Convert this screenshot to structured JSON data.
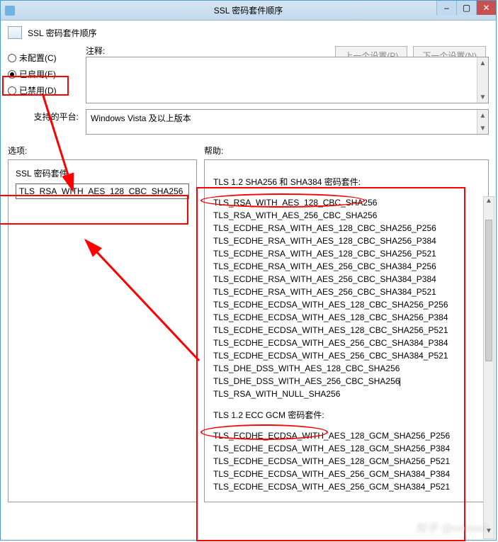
{
  "window": {
    "title": "SSL 密码套件顺序",
    "buttons": {
      "min": "–",
      "max": "▢",
      "close": "✕"
    }
  },
  "header": {
    "title": "SSL 密码套件顺序"
  },
  "nav": {
    "prev": "上一个设置(P)",
    "next": "下一个设置(N)"
  },
  "radios": {
    "not_configured": "未配置(C)",
    "enabled": "已启用(E)",
    "disabled": "已禁用(D)"
  },
  "labels": {
    "comment": "注释:",
    "platform": "支持的平台:",
    "options": "选项:",
    "help": "帮助:",
    "suite": "SSL 密码套件"
  },
  "platform_text": "Windows Vista 及以上版本",
  "suite_input": "TLS_RSA_WITH_AES_128_CBC_SHA256",
  "help": {
    "h1": "TLS 1.2 SHA256 和 SHA384 密码套件:",
    "list1": [
      "TLS_RSA_WITH_AES_128_CBC_SHA256",
      "TLS_RSA_WITH_AES_256_CBC_SHA256",
      "TLS_ECDHE_RSA_WITH_AES_128_CBC_SHA256_P256",
      "TLS_ECDHE_RSA_WITH_AES_128_CBC_SHA256_P384",
      "TLS_ECDHE_RSA_WITH_AES_128_CBC_SHA256_P521",
      "TLS_ECDHE_RSA_WITH_AES_256_CBC_SHA384_P256",
      "TLS_ECDHE_RSA_WITH_AES_256_CBC_SHA384_P384",
      "TLS_ECDHE_RSA_WITH_AES_256_CBC_SHA384_P521",
      "TLS_ECDHE_ECDSA_WITH_AES_128_CBC_SHA256_P256",
      "TLS_ECDHE_ECDSA_WITH_AES_128_CBC_SHA256_P384",
      "TLS_ECDHE_ECDSA_WITH_AES_128_CBC_SHA256_P521",
      "TLS_ECDHE_ECDSA_WITH_AES_256_CBC_SHA384_P384",
      "TLS_ECDHE_ECDSA_WITH_AES_256_CBC_SHA384_P521",
      "TLS_DHE_DSS_WITH_AES_128_CBC_SHA256",
      "TLS_DHE_DSS_WITH_AES_256_CBC_SHA256",
      "TLS_RSA_WITH_NULL_SHA256"
    ],
    "h2": "TLS 1.2 ECC GCM 密码套件:",
    "list2": [
      "TLS_ECDHE_ECDSA_WITH_AES_128_GCM_SHA256_P256",
      "TLS_ECDHE_ECDSA_WITH_AES_128_GCM_SHA256_P384",
      "TLS_ECDHE_ECDSA_WITH_AES_128_GCM_SHA256_P521",
      "TLS_ECDHE_ECDSA_WITH_AES_256_GCM_SHA384_P384",
      "TLS_ECDHE_ECDSA_WITH_AES_256_GCM_SHA384_P521"
    ]
  },
  "watermark": "知乎 @onme0"
}
